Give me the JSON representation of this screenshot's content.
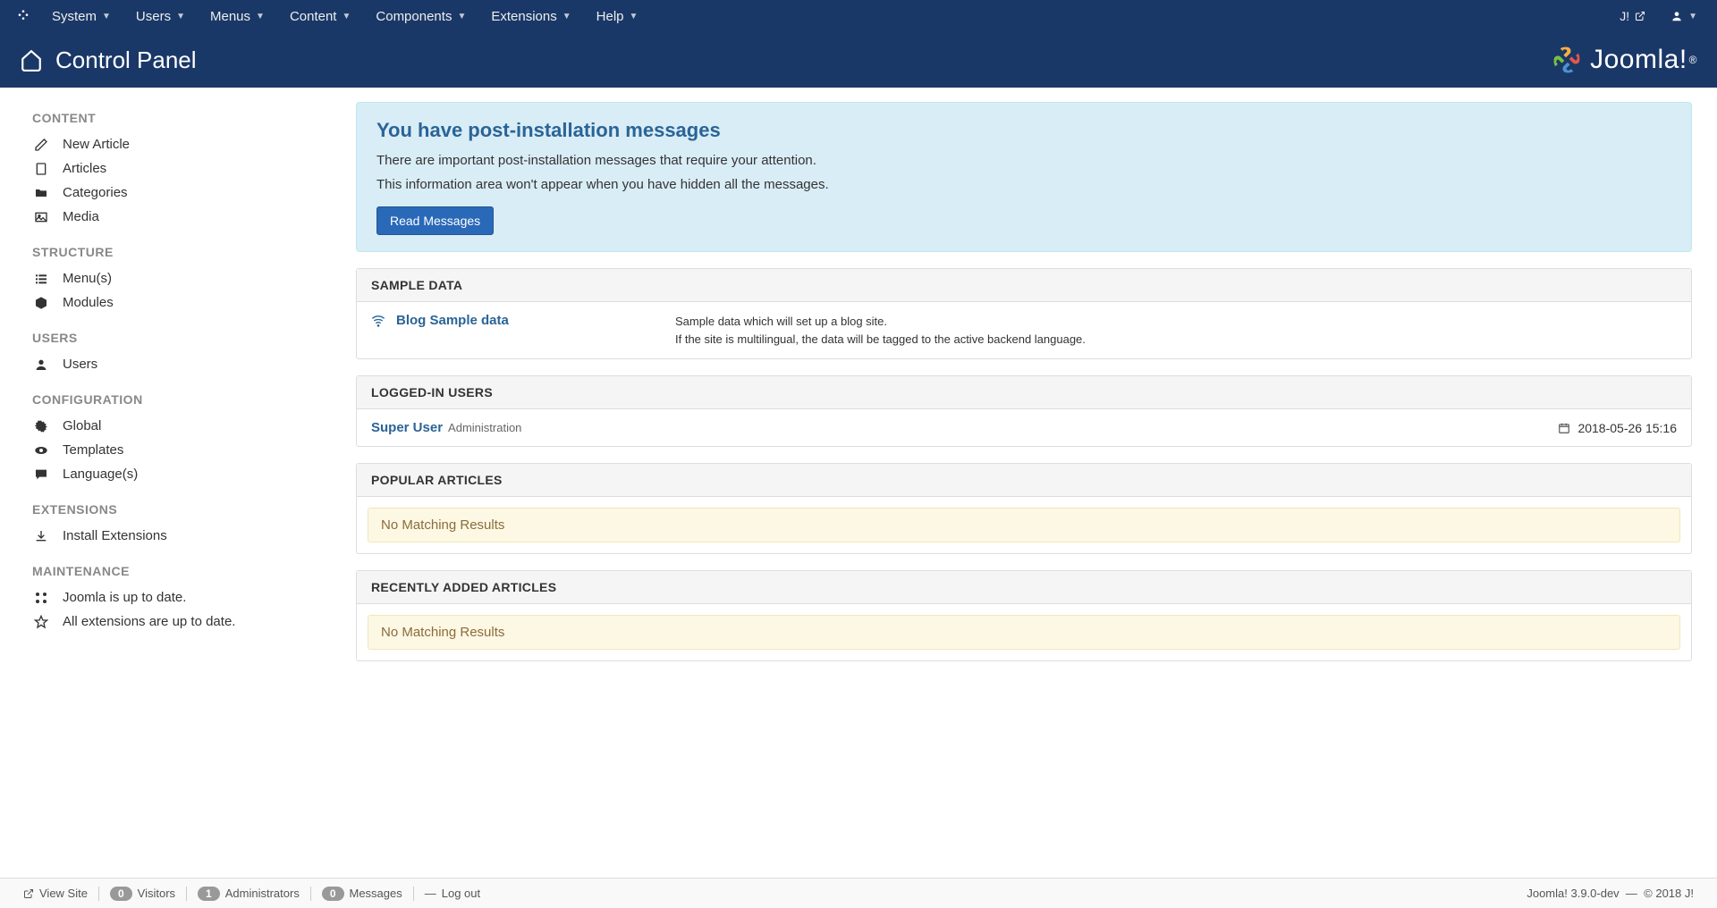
{
  "topmenu": {
    "items": [
      "System",
      "Users",
      "Menus",
      "Content",
      "Components",
      "Extensions",
      "Help"
    ],
    "right_label": "J!",
    "user_caret": "▼"
  },
  "header": {
    "title": "Control Panel",
    "logo_text": "Joomla!",
    "logo_r": "®"
  },
  "sidebar": {
    "sections": [
      {
        "title": "CONTENT",
        "items": [
          {
            "icon": "pencil",
            "label": "New Article"
          },
          {
            "icon": "file",
            "label": "Articles"
          },
          {
            "icon": "folder",
            "label": "Categories"
          },
          {
            "icon": "image",
            "label": "Media"
          }
        ]
      },
      {
        "title": "STRUCTURE",
        "items": [
          {
            "icon": "list",
            "label": "Menu(s)"
          },
          {
            "icon": "cube",
            "label": "Modules"
          }
        ]
      },
      {
        "title": "USERS",
        "items": [
          {
            "icon": "user",
            "label": "Users"
          }
        ]
      },
      {
        "title": "CONFIGURATION",
        "items": [
          {
            "icon": "gear",
            "label": "Global"
          },
          {
            "icon": "eye",
            "label": "Templates"
          },
          {
            "icon": "comment",
            "label": "Language(s)"
          }
        ]
      },
      {
        "title": "EXTENSIONS",
        "items": [
          {
            "icon": "download",
            "label": "Install Extensions"
          }
        ]
      },
      {
        "title": "MAINTENANCE",
        "items": [
          {
            "icon": "joomla",
            "label": "Joomla is up to date."
          },
          {
            "icon": "star",
            "label": "All extensions are up to date."
          }
        ]
      }
    ]
  },
  "alert": {
    "title": "You have post-installation messages",
    "line1": "There are important post-installation messages that require your attention.",
    "line2": "This information area won't appear when you have hidden all the messages.",
    "button": "Read Messages"
  },
  "panels": {
    "sample": {
      "title": "SAMPLE DATA",
      "item_label": "Blog Sample data",
      "desc1": "Sample data which will set up a blog site.",
      "desc2": "If the site is multilingual, the data will be tagged to the active backend language."
    },
    "logged": {
      "title": "LOGGED-IN USERS",
      "user": "Super User",
      "sub": "Administration",
      "date": "2018-05-26 15:16"
    },
    "popular": {
      "title": "POPULAR ARTICLES",
      "empty": "No Matching Results"
    },
    "recent": {
      "title": "RECENTLY ADDED ARTICLES",
      "empty": "No Matching Results"
    }
  },
  "footer": {
    "viewsite": "View Site",
    "visitors_badge": "0",
    "visitors": "Visitors",
    "admins_badge": "1",
    "admins": "Administrators",
    "messages_badge": "0",
    "messages": "Messages",
    "logout": "Log out",
    "version": "Joomla! 3.9.0-dev",
    "dash": "—",
    "copyright": "© 2018 J!"
  }
}
